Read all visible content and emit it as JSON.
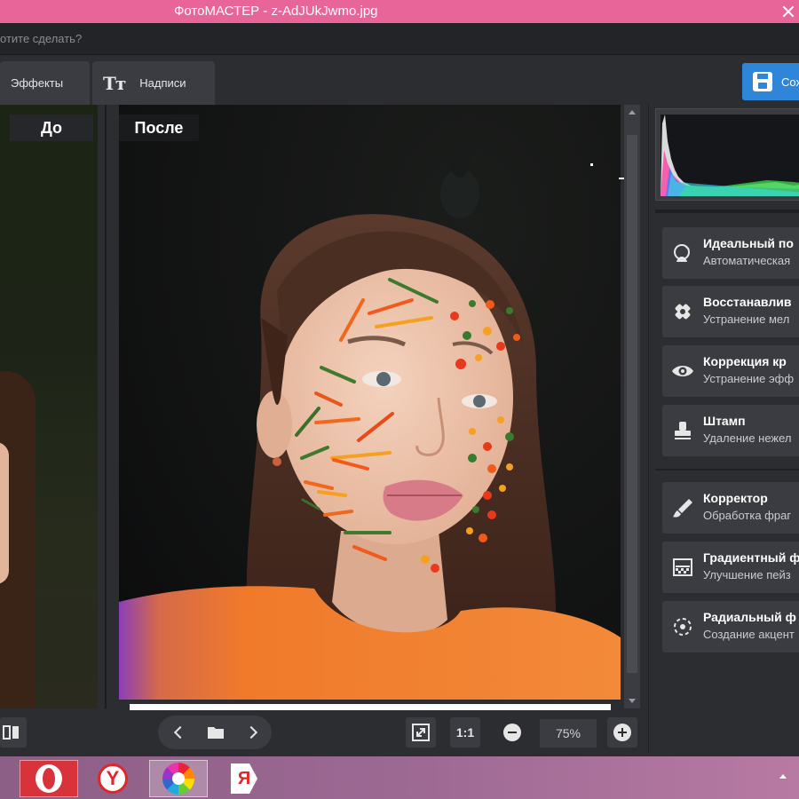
{
  "window": {
    "title": "ФотоМАСТЕР - z-AdJUkJwmo.jpg"
  },
  "search": {
    "placeholder": "отите сделать?"
  },
  "tabs": [
    {
      "label": "Эффекты"
    },
    {
      "label": "Надписи",
      "icon": "text-tt-icon"
    }
  ],
  "toolbar": {
    "save_label": "Сох"
  },
  "preview": {
    "before_label": "До",
    "after_label": "После"
  },
  "bottom": {
    "zoom_one_to_one": "1:1",
    "zoom_value": "75%"
  },
  "tools": [
    {
      "title": "Идеальный по",
      "subtitle": "Автоматическая",
      "icon": "portrait-icon"
    },
    {
      "title": "Восстанавлив",
      "subtitle": "Устранение мел",
      "icon": "patch-icon"
    },
    {
      "title": "Коррекция кр",
      "subtitle": "Устранение эфф",
      "icon": "eye-icon"
    },
    {
      "title": "Штамп",
      "subtitle": "Удаление нежел",
      "icon": "stamp-icon"
    },
    {
      "title": "Корректор",
      "subtitle": "Обработка фраг",
      "icon": "brush-icon"
    },
    {
      "title": "Градиентный ф",
      "subtitle": "Улучшение пейз",
      "icon": "gradient-icon"
    },
    {
      "title": "Радиальный ф",
      "subtitle": "Создание акцент",
      "icon": "radial-icon"
    }
  ],
  "taskbar": {
    "apps": [
      "opera",
      "yandex",
      "fotomaster",
      "yandex-browser"
    ],
    "yandex_glyph": "Y",
    "yabrowser_glyph": "Я"
  },
  "colors": {
    "titlebar": "#e8659a",
    "accent": "#2f86d8",
    "panel": "#3a3c41",
    "background": "#2b2d31"
  }
}
